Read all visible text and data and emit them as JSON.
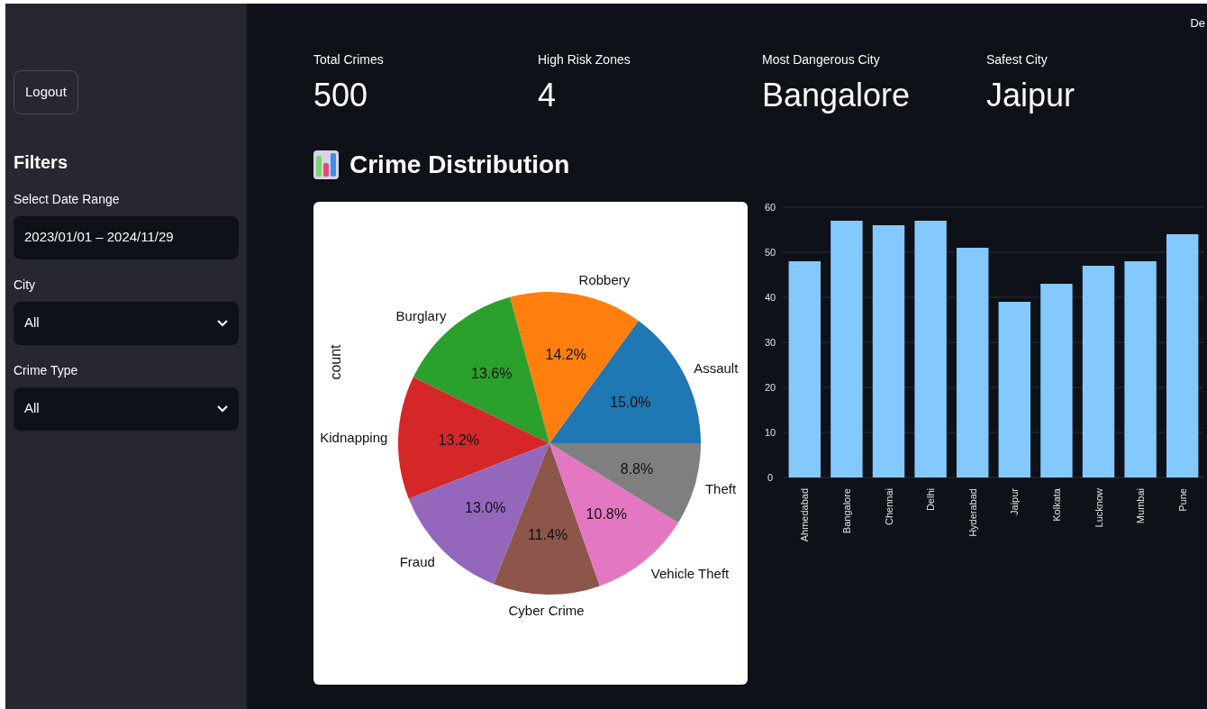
{
  "header_text": "De",
  "sidebar": {
    "logout_button": "Logout",
    "filters_title": "Filters",
    "filters": [
      {
        "kind": "date",
        "label": "Select Date Range",
        "value": "2023/01/01 – 2024/11/29"
      },
      {
        "kind": "select",
        "label": "City",
        "value": "All"
      },
      {
        "kind": "select",
        "label": "Crime Type",
        "value": "All"
      }
    ]
  },
  "metrics": [
    {
      "label": "Total Crimes",
      "value": "500"
    },
    {
      "label": "High Risk Zones",
      "value": "4"
    },
    {
      "label": "Most Dangerous City",
      "value": "Bangalore"
    },
    {
      "label": "Safest City",
      "value": "Jaipur"
    }
  ],
  "section_title": "Crime Distribution",
  "pie_chart": {
    "chart_data": {
      "type": "pie",
      "ylabel": "count",
      "categories": [
        "Assault",
        "Robbery",
        "Burglary",
        "Kidnapping",
        "Fraud",
        "Cyber Crime",
        "Vehicle Theft",
        "Theft"
      ],
      "series": [
        {
          "values": [
            15.0,
            14.2,
            13.6,
            13.2,
            13.0,
            11.4,
            10.8,
            8.8
          ]
        }
      ],
      "colors": [
        "#1f77b4",
        "#ff7f0e",
        "#2ca02c",
        "#d62728",
        "#9467bd",
        "#8c564b",
        "#e377c2",
        "#7f7f7f"
      ],
      "value_labels": [
        "15.0%",
        "14.2%",
        "13.6%",
        "13.2%",
        "13.0%",
        "11.4%",
        "10.8%",
        "8.8%"
      ]
    }
  },
  "bar_chart": {
    "chart_data": {
      "type": "bar",
      "categories": [
        "Ahmedabad",
        "Bangalore",
        "Chennai",
        "Delhi",
        "Hyderabad",
        "Jaipur",
        "Kolkata",
        "Lucknow",
        "Mumbai",
        "Pune"
      ],
      "series": [
        {
          "color": "#83c9ff",
          "values": [
            48,
            57,
            56,
            57,
            51,
            39,
            43,
            47,
            48,
            54
          ]
        }
      ],
      "ylim": [
        0,
        60
      ],
      "yticks": [
        0,
        10,
        20,
        30,
        40,
        50,
        60
      ],
      "grid": true
    }
  }
}
